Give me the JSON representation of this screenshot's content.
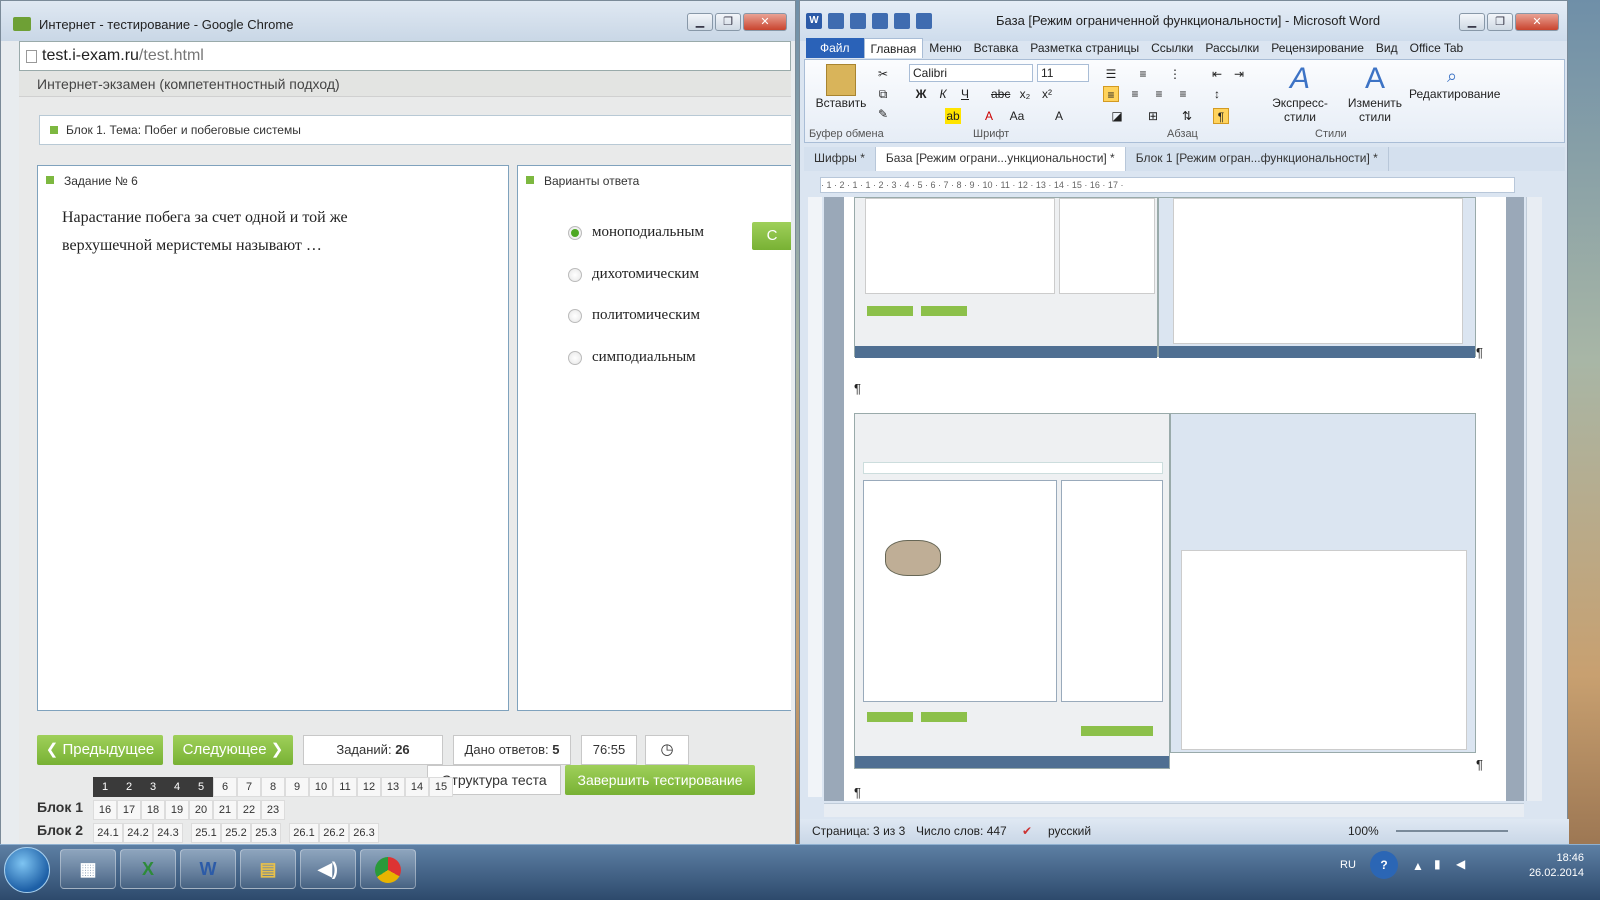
{
  "chrome": {
    "title": "Интернет - тестирование - Google Chrome",
    "url_host": "test.i-exam.ru",
    "url_path": "/test.html",
    "exam_header": "Интернет-экзамен (компетентностный подход)",
    "block_title": "Блок 1. Тема: Побег и побеговые системы",
    "task_label": "Задание № 6",
    "question": "Нарастание побега за счет одной и той же верхушечной меристемы называют …",
    "answers_label": "Варианты ответа",
    "options": [
      {
        "text": "моноподиальным",
        "selected": true
      },
      {
        "text": "дихотомическим",
        "selected": false
      },
      {
        "text": "политомическим",
        "selected": false
      },
      {
        "text": "симподиальным",
        "selected": false
      }
    ],
    "side_button": "С",
    "prev_label": "Предыдущее",
    "next_label": "Следующее",
    "tasks_label": "Заданий:",
    "tasks_count": "26",
    "answered_label": "Дано ответов:",
    "answered_count": "5",
    "timer": "76:55",
    "structure_label": "Структура теста",
    "finish_label": "Завершить тестирование",
    "grid_row0": [
      "1",
      "2",
      "3",
      "4",
      "5",
      "6",
      "7",
      "8",
      "9",
      "10",
      "11",
      "12",
      "13",
      "14",
      "15"
    ],
    "grid_row0_done": 5,
    "block1_label": "Блок 1",
    "grid_row1": [
      "16",
      "17",
      "18",
      "19",
      "20",
      "21",
      "22",
      "23"
    ],
    "block2_label": "Блок 2",
    "grid_row2": [
      "24.1",
      "24.2",
      "24.3",
      "25.1",
      "25.2",
      "25.3",
      "26.1",
      "26.2",
      "26.3"
    ]
  },
  "word": {
    "title": "База [Режим ограниченной функциональности] - Microsoft Word",
    "tabs": [
      "Файл",
      "Главная",
      "Меню",
      "Вставка",
      "Разметка страницы",
      "Ссылки",
      "Рассылки",
      "Рецензирование",
      "Вид",
      "Office Tab"
    ],
    "paste": "Вставить",
    "clipboard": "Буфер обмена",
    "font_name": "Calibri",
    "font_size": "11",
    "font_group": "Шрифт",
    "para_group": "Абзац",
    "express_styles": "Экспресс-стили",
    "change_styles": "Изменить стили",
    "styles_group": "Стили",
    "editing": "Редактирование",
    "doc_tabs": [
      "Шифры *",
      "База [Режим ограни...ункциональности] *",
      "Блок 1 [Режим огран...функциональности] *"
    ],
    "ruler_text": "· 1 · 2 · 1 · 1 · 2 · 3 · 4 · 5 · 6 · 7 · 8 · 9 · 10 · 11 · 12 · 13 · 14 · 15 · 16 · 17 ·",
    "pilcrow": "¶",
    "status_page": "Страница: 3 из 3",
    "status_words": "Число слов: 447",
    "status_lang": "русский",
    "zoom": "100%"
  },
  "taskbar": {
    "lang": "RU",
    "time": "18:46",
    "date": "26.02.2014"
  }
}
